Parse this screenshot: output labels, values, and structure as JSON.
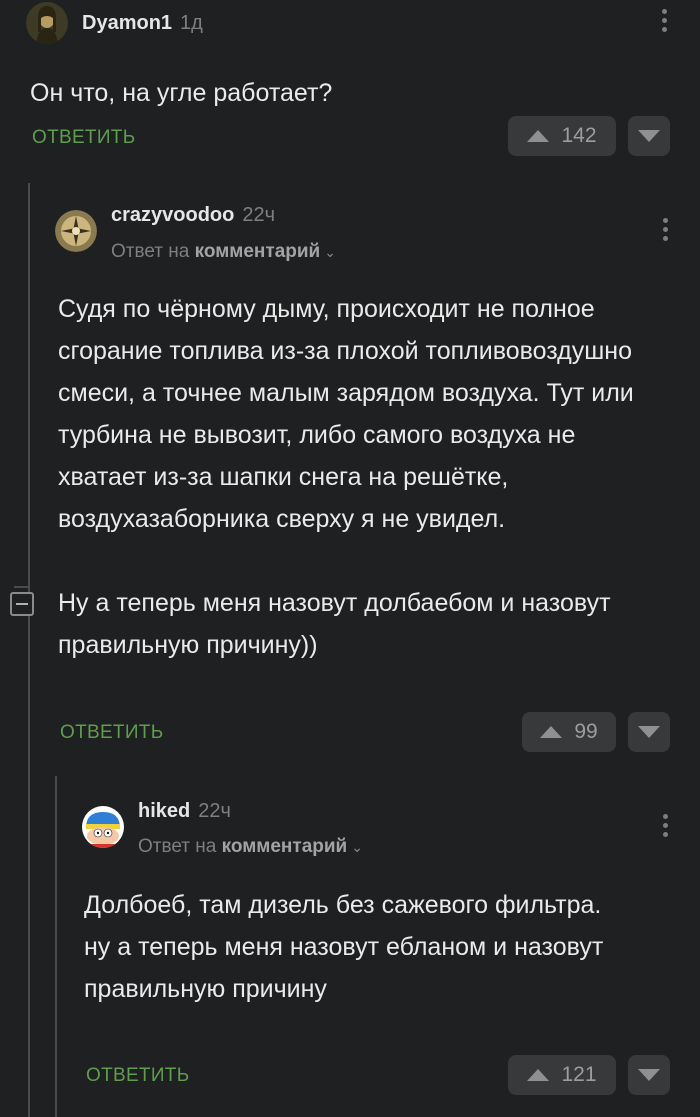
{
  "comments": [
    {
      "username": "Dyamon1",
      "time": "1д",
      "paragraphs": [
        "Он что, на угле работает?"
      ],
      "reply_label": "ОТВЕТИТЬ",
      "rating": "142"
    },
    {
      "username": "crazyvoodoo",
      "time": "22ч",
      "reply_to_prefix": "Ответ на",
      "reply_to_target": "комментарий",
      "paragraphs": [
        "Судя по чёрному дыму, происходит не полное сгорание топлива из-за плохой топливовоздушно смеси, а точнее малым зарядом воздуха. Тут или турбина не вывозит, либо самого воздуха не хватает из-за шапки снега на решётке, воздухазаборника сверху я не увидел.",
        "Ну а теперь меня назовут долбаебом и назовут правильную причину))"
      ],
      "reply_label": "ОТВЕТИТЬ",
      "rating": "99"
    },
    {
      "username": "hiked",
      "time": "22ч",
      "reply_to_prefix": "Ответ на",
      "reply_to_target": "комментарий",
      "paragraphs": [
        "Долбоеб, там дизель без сажевого фильтра.",
        "ну а теперь меня назовут ебланом и назовут правильную причину"
      ],
      "reply_label": "ОТВЕТИТЬ",
      "rating": "121"
    }
  ],
  "icons": {
    "more": "more-vertical-icon",
    "collapse": "collapse-minus-icon",
    "upvote": "arrow-up-icon",
    "downvote": "arrow-down-icon",
    "reply_chevron": "chevron-down-icon"
  },
  "colors": {
    "background": "#1f2021",
    "reply_green": "#5e9e4c",
    "button_bg": "#38393b"
  }
}
